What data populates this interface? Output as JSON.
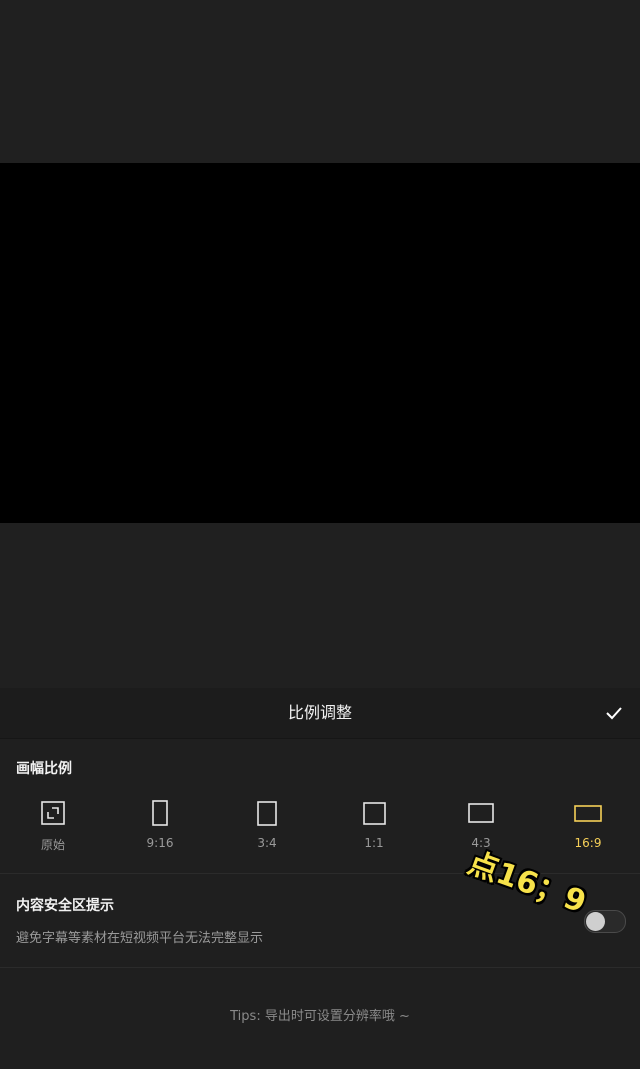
{
  "panel": {
    "title": "比例调整",
    "confirm_icon": "checkmark-icon"
  },
  "aspect": {
    "section_label": "画幅比例",
    "options": [
      {
        "label": "原始",
        "icon": "original-ratio-icon",
        "selected": false
      },
      {
        "label": "9:16",
        "icon": "portrait-9-16-icon",
        "selected": false
      },
      {
        "label": "3:4",
        "icon": "portrait-3-4-icon",
        "selected": false
      },
      {
        "label": "1:1",
        "icon": "square-1-1-icon",
        "selected": false
      },
      {
        "label": "4:3",
        "icon": "landscape-4-3-icon",
        "selected": false
      },
      {
        "label": "16:9",
        "icon": "landscape-16-9-icon",
        "selected": true
      }
    ]
  },
  "safe_area": {
    "title": "内容安全区提示",
    "description": "避免字幕等素材在短视频平台无法完整显示",
    "toggle_on": false
  },
  "tips": "Tips: 导出时可设置分辨率哦 ~",
  "overlay": {
    "caption": "点16；9"
  },
  "colors": {
    "accent": "#f5cf58",
    "background": "#1f1f1f",
    "preview": "#000000",
    "caption": "#f7e24a"
  }
}
